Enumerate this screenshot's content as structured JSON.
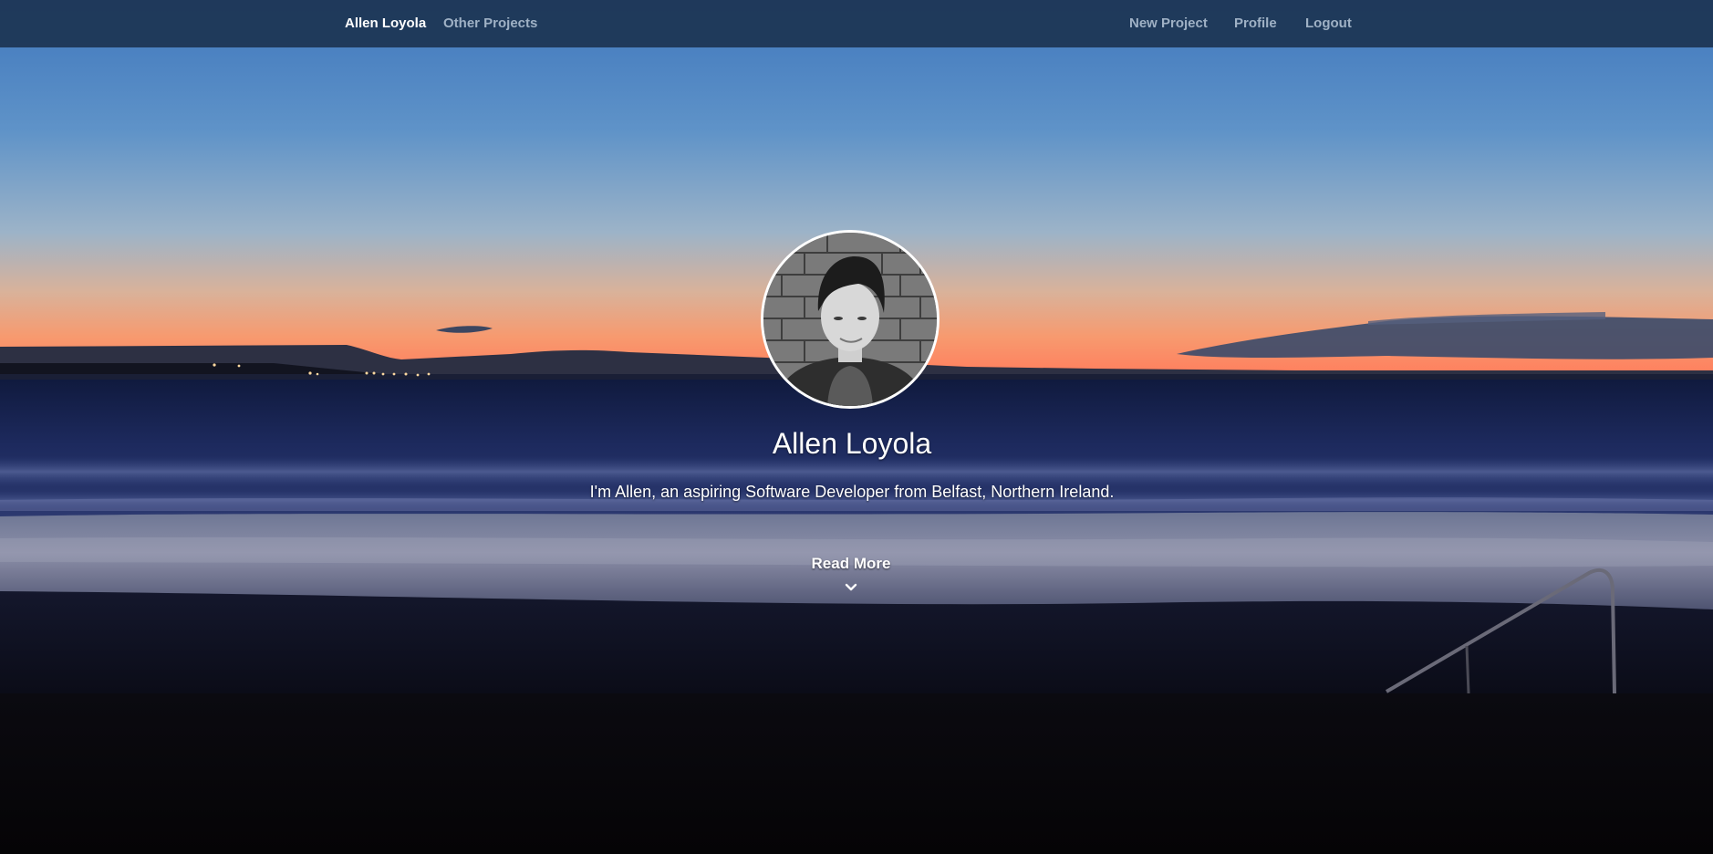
{
  "navbar": {
    "brand": "Allen Loyola",
    "left_links": [
      {
        "label": "Other Projects"
      }
    ],
    "right_links": [
      {
        "label": "New Project"
      },
      {
        "label": "Profile"
      },
      {
        "label": "Logout"
      }
    ]
  },
  "hero": {
    "name": "Allen Loyola",
    "bio": "I'm Allen, an aspiring Software Developer from Belfast, Northern Ireland.",
    "read_more_label": "Read More",
    "read_more_icon": "chevron-down-icon",
    "avatar_icon": "profile-photo"
  },
  "colors": {
    "navbar_bg": "#1c3452",
    "nav_link": "#9fb1c5",
    "nav_brand": "#ffffff",
    "avatar_border": "#ffffff",
    "sky_top": "#4a82c4",
    "sunset_glow": "#ff8f66",
    "sea": "#1b2652"
  }
}
